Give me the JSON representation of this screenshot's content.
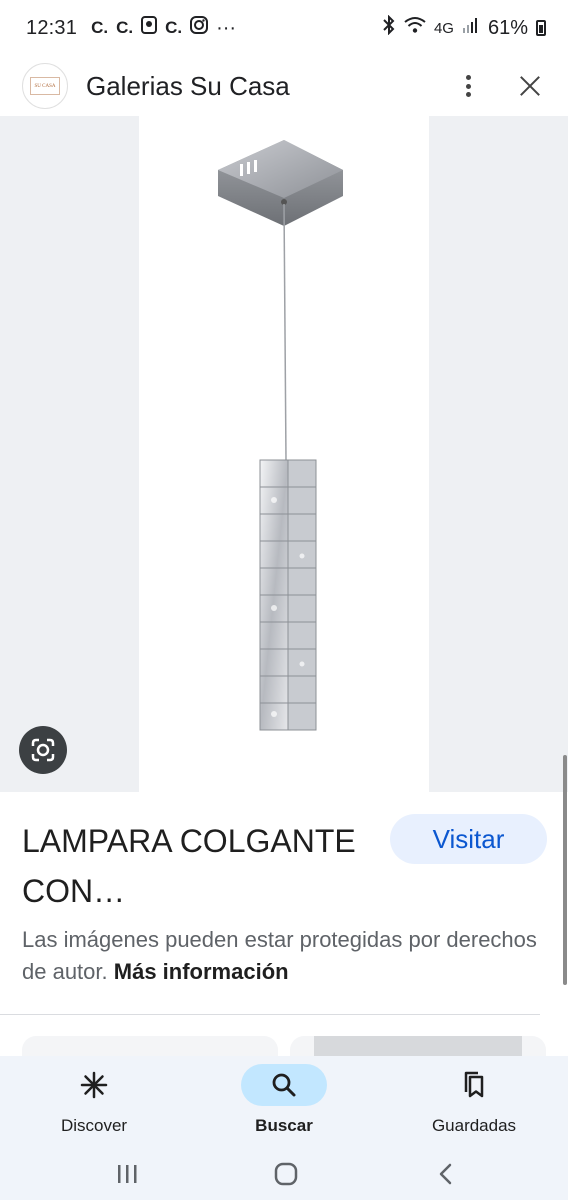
{
  "status_bar": {
    "time": "12:31",
    "notifications": [
      "C.",
      "C.",
      "C."
    ],
    "more": "···",
    "network": "4G",
    "battery": "61%"
  },
  "header": {
    "favicon_text": "SU CASA",
    "site_name": "Galerias Su Casa"
  },
  "product": {
    "title": "LAMPARA COLGANTE CON…",
    "visit_label": "Visitar"
  },
  "notice": {
    "text": "Las imágenes pueden estar protegidas por derechos de autor.",
    "more_link": "Más información"
  },
  "bottom_nav": {
    "items": [
      {
        "label": "Discover",
        "icon": "asterisk-icon",
        "active": false
      },
      {
        "label": "Buscar",
        "icon": "search-icon",
        "active": true
      },
      {
        "label": "Guardadas",
        "icon": "bookmarks-icon",
        "active": false
      }
    ]
  },
  "colors": {
    "accent": "#0b57d0",
    "visit_bg": "#e8f0fe",
    "active_pill": "#c2e7ff",
    "nav_bg": "#f0f4fa"
  }
}
